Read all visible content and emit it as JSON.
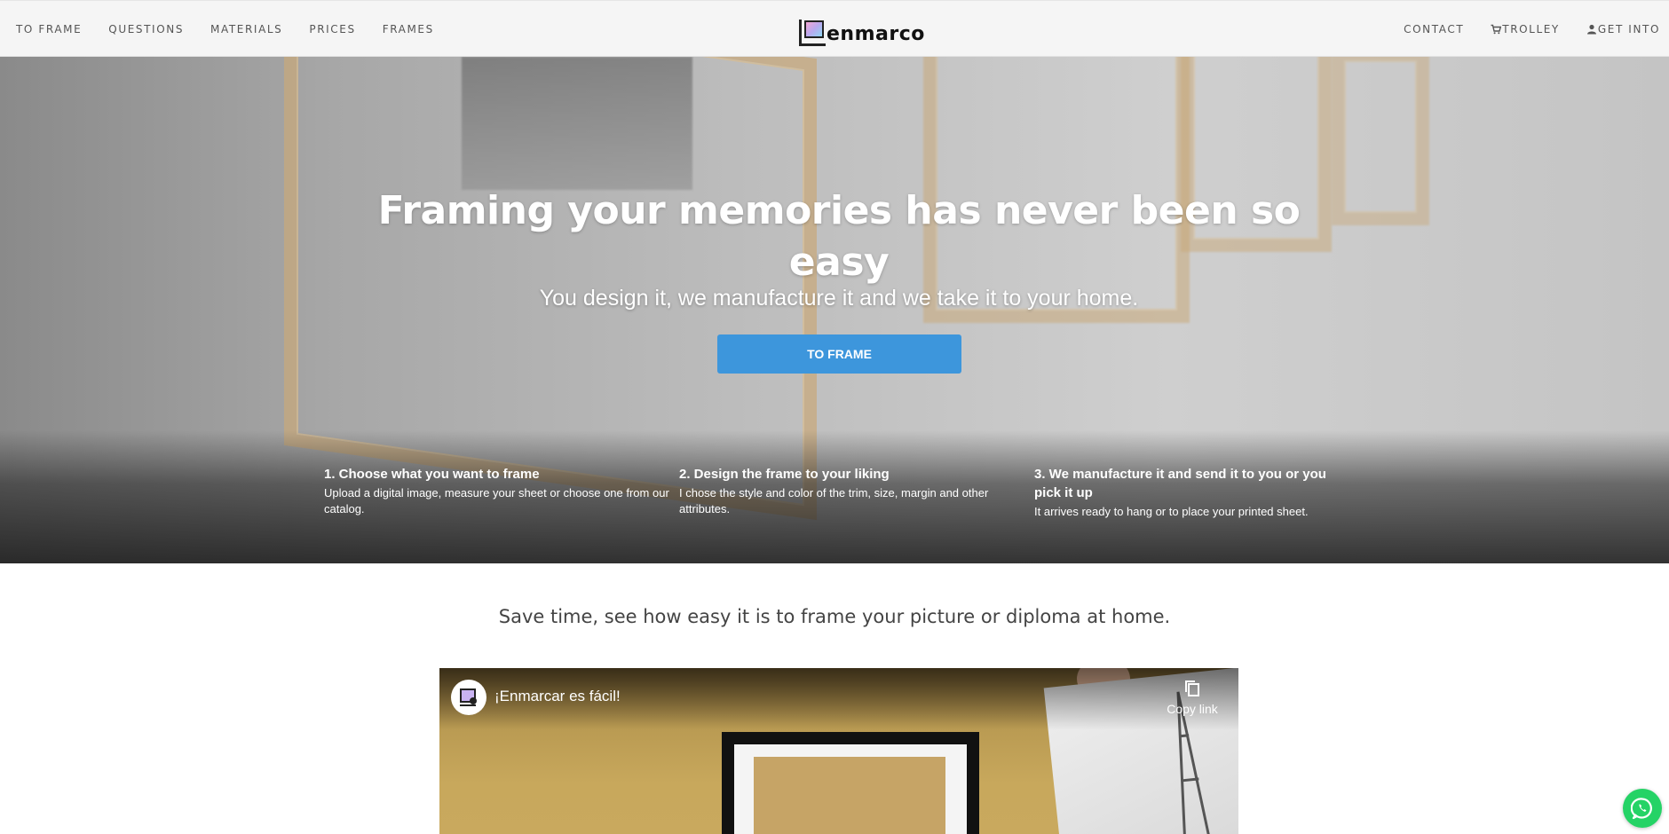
{
  "nav": {
    "left": [
      "TO FRAME",
      "QUESTIONS",
      "MATERIALS",
      "PRICES",
      "FRAMES"
    ],
    "right": {
      "contact": "CONTACT",
      "trolley": "TROLLEY",
      "get_into": "GET INTO"
    },
    "brand": "enmarco",
    "icons": {
      "trolley": "cart-icon",
      "get_into": "user-icon"
    }
  },
  "hero": {
    "title": "Framing your memories has never been so easy",
    "subtitle": "You design it, we manufacture it and we take it to your home.",
    "cta": "TO FRAME",
    "steps": [
      {
        "title": "1. Choose what you want to frame",
        "text": "Upload a digital image, measure your sheet or choose one from our catalog."
      },
      {
        "title": "2. Design the frame to your liking",
        "text": "I chose the style and color of the trim, size, margin and other attributes."
      },
      {
        "title": "3. We manufacture it and send it to you or you pick it up",
        "text": "It arrives ready to hang or to place your printed sheet."
      }
    ]
  },
  "section": {
    "tagline": "Save time, see how easy it is to frame your picture or diploma at home."
  },
  "video": {
    "title": "¡Enmarcar es fácil!",
    "copy_link": "Copy link"
  },
  "colors": {
    "accent": "#3d96dc",
    "whatsapp": "#25d366",
    "nav_bg": "#f5f5f5"
  }
}
